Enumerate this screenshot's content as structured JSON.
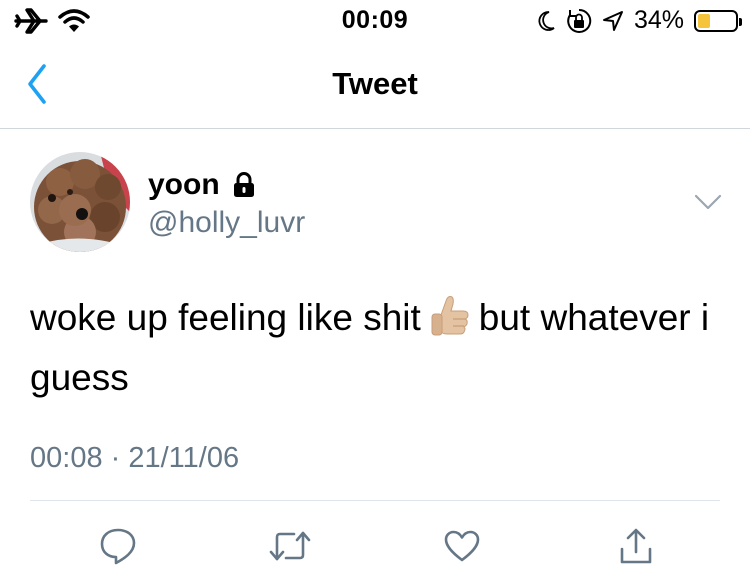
{
  "status_bar": {
    "time": "00:09",
    "battery_percent_label": "34%",
    "battery_level": 0.34,
    "battery_color": "#f6c43a",
    "icons": [
      "airplane-icon",
      "wifi-icon",
      "moon-icon",
      "orientation-lock-icon",
      "location-icon"
    ]
  },
  "nav": {
    "title": "Tweet",
    "accent_color": "#1da1f2"
  },
  "tweet": {
    "display_name": "yoon",
    "handle": "@holly_luvr",
    "protected_icon": "lock-icon",
    "text_before_emoji": "woke up feeling like shit",
    "emoji": "thumbs-up-light-skin-tone",
    "text_after_emoji": "but whatever i guess",
    "timestamp": "00:08 · 21/11/06",
    "secondary_color": "#657786"
  },
  "actions": [
    "reply-icon",
    "retweet-icon",
    "like-icon",
    "share-icon"
  ]
}
